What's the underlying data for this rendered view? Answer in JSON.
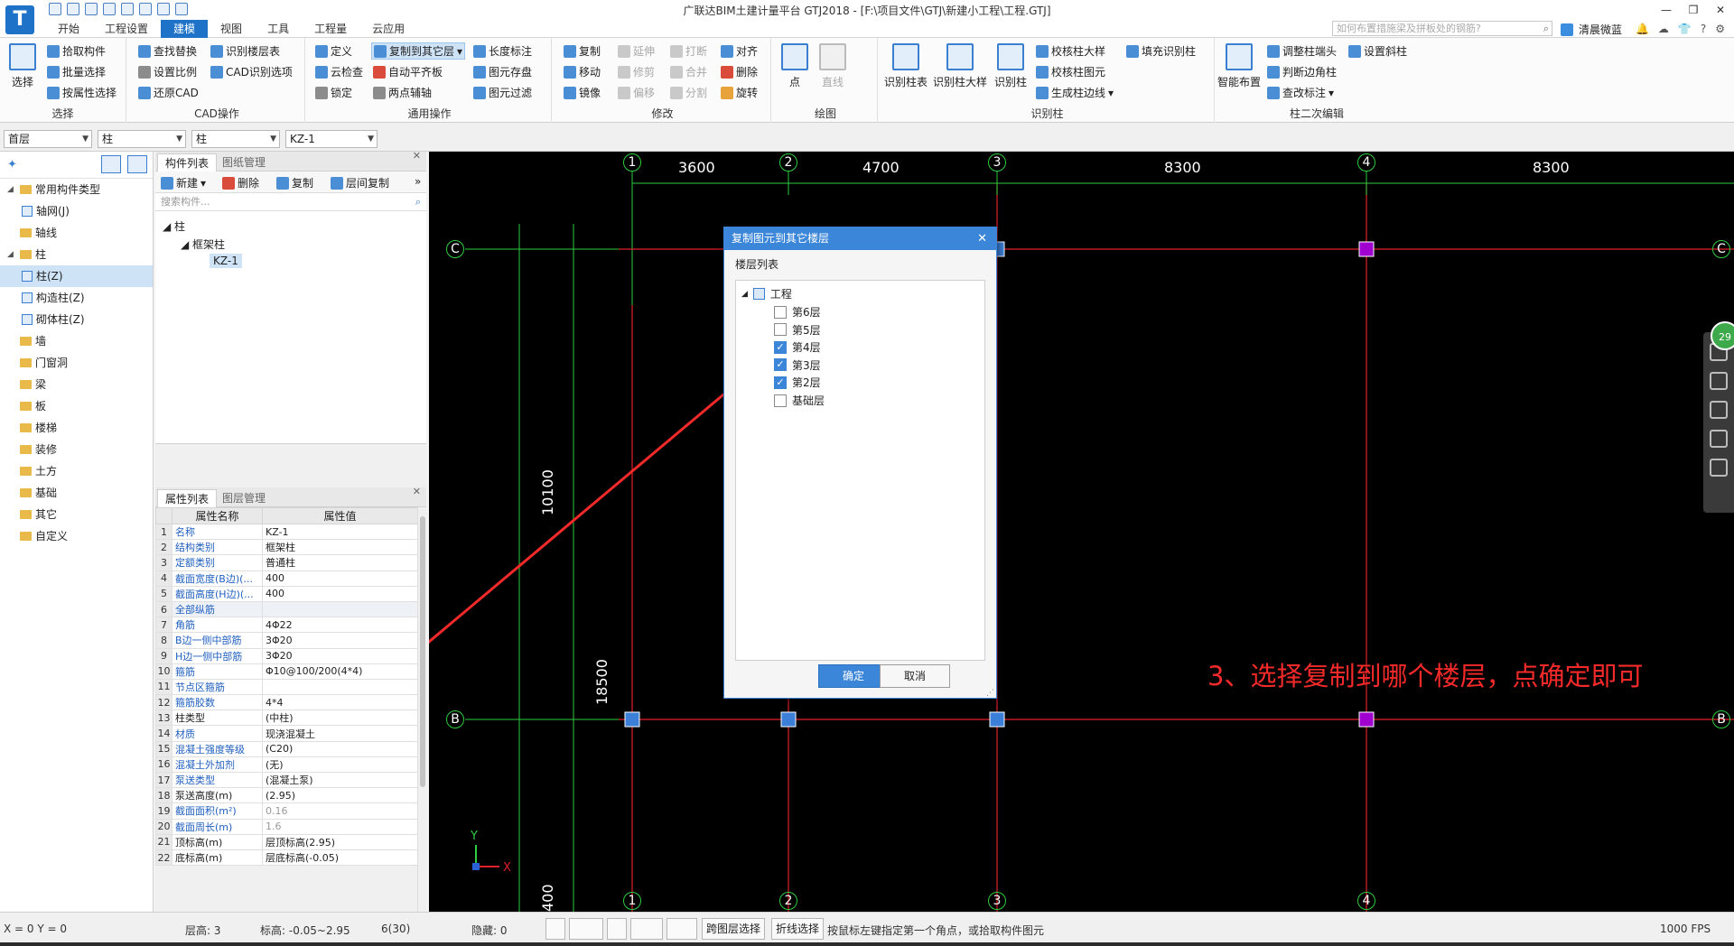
{
  "window": {
    "title": "广联达BIM土建计量平台 GTJ2018 - [F:\\项目文件\\GTJ\\新建小工程\\工程.GTJ]",
    "logo_letter": "T",
    "controls": [
      "—",
      "❐",
      "✕"
    ]
  },
  "menu_tabs": [
    "开始",
    "工程设置",
    "建模",
    "视图",
    "工具",
    "工程量",
    "云应用"
  ],
  "active_tab": "建模",
  "top_search_placeholder": "如何布置措施梁及拼板处的钢筋?",
  "user": {
    "name": "清晨微蓝"
  },
  "ribbon": {
    "select_group": {
      "label": "选择",
      "big": "选择",
      "items": [
        "拾取构件",
        "批量选择",
        "按属性选择"
      ]
    },
    "cad_group": {
      "label": "CAD操作",
      "items": [
        "查找替换",
        "识别楼层表",
        "设置比例",
        "CAD识别选项",
        "还原CAD"
      ]
    },
    "common_group": {
      "label": "通用操作",
      "items": [
        "定义",
        "复制到其它层",
        "长度标注",
        "云检查",
        "自动平齐板",
        "图元存盘",
        "锁定",
        "两点辅轴",
        "图元过滤"
      ]
    },
    "modify_group": {
      "label": "修改",
      "items": [
        "复制",
        "延伸",
        "打断",
        "对齐",
        "移动",
        "修剪",
        "合并",
        "删除",
        "镜像",
        "偏移",
        "分割",
        "旋转"
      ]
    },
    "draw_group": {
      "label": "绘图",
      "items": [
        "点",
        "直线"
      ]
    },
    "identify_group": {
      "label": "识别柱",
      "big": [
        "识别柱表",
        "识别柱大样",
        "识别柱"
      ],
      "items": [
        "校核柱大样",
        "填充识别柱",
        "校核柱图元",
        "生成柱边线"
      ]
    },
    "second_edit_group": {
      "label": "柱二次编辑",
      "big": "智能布置",
      "items": [
        "调整柱端头",
        "设置斜柱",
        "判断边角柱",
        "查改标注"
      ]
    }
  },
  "selectors": [
    "首层",
    "柱",
    "柱",
    "KZ-1"
  ],
  "left_tree": {
    "header": "常用构件类型",
    "items": [
      {
        "label": "常用构件类型",
        "level": 0,
        "expanded": true
      },
      {
        "label": "轴网(J)",
        "level": 1
      },
      {
        "label": "轴线",
        "level": 0
      },
      {
        "label": "柱",
        "level": 0,
        "expanded": true
      },
      {
        "label": "柱(Z)",
        "level": 1,
        "selected": true
      },
      {
        "label": "构造柱(Z)",
        "level": 1
      },
      {
        "label": "砌体柱(Z)",
        "level": 1
      },
      {
        "label": "墙",
        "level": 0
      },
      {
        "label": "门窗洞",
        "level": 0
      },
      {
        "label": "梁",
        "level": 0
      },
      {
        "label": "板",
        "level": 0
      },
      {
        "label": "楼梯",
        "level": 0
      },
      {
        "label": "装修",
        "level": 0
      },
      {
        "label": "土方",
        "level": 0
      },
      {
        "label": "基础",
        "level": 0
      },
      {
        "label": "其它",
        "level": 0
      },
      {
        "label": "自定义",
        "level": 0
      }
    ]
  },
  "component_panel": {
    "tabs": [
      "构件列表",
      "图纸管理"
    ],
    "tools": [
      "新建",
      "删除",
      "复制",
      "层间复制"
    ],
    "search_placeholder": "搜索构件...",
    "tree": [
      "柱",
      "框架柱",
      "KZ-1"
    ]
  },
  "property_panel": {
    "tabs": [
      "属性列表",
      "图层管理"
    ],
    "headers": [
      "属性名称",
      "属性值"
    ],
    "rows": [
      {
        "n": "1",
        "name": "名称",
        "value": "KZ-1",
        "blue": true
      },
      {
        "n": "2",
        "name": "结构类别",
        "value": "框架柱",
        "blue": true
      },
      {
        "n": "3",
        "name": "定额类别",
        "value": "普通柱",
        "blue": true
      },
      {
        "n": "4",
        "name": "截面宽度(B边)(...",
        "value": "400",
        "blue": true
      },
      {
        "n": "5",
        "name": "截面高度(H边)(...",
        "value": "400",
        "blue": true
      },
      {
        "n": "6",
        "name": "全部纵筋",
        "value": "",
        "blue": true,
        "group": true
      },
      {
        "n": "7",
        "name": "角筋",
        "value": "4Φ22",
        "blue": true
      },
      {
        "n": "8",
        "name": "B边一侧中部筋",
        "value": "3Φ20",
        "blue": true
      },
      {
        "n": "9",
        "name": "H边一侧中部筋",
        "value": "3Φ20",
        "blue": true
      },
      {
        "n": "10",
        "name": "箍筋",
        "value": "Φ10@100/200(4*4)",
        "blue": true
      },
      {
        "n": "11",
        "name": "节点区箍筋",
        "value": "",
        "blue": true
      },
      {
        "n": "12",
        "name": "箍筋胶数",
        "value": "4*4",
        "blue": true
      },
      {
        "n": "13",
        "name": "柱类型",
        "value": "(中柱)",
        "blue": false
      },
      {
        "n": "14",
        "name": "材质",
        "value": "现浇混凝土",
        "blue": true
      },
      {
        "n": "15",
        "name": "混凝土强度等级",
        "value": "(C20)",
        "blue": true
      },
      {
        "n": "16",
        "name": "混凝土外加剂",
        "value": "(无)",
        "blue": true
      },
      {
        "n": "17",
        "name": "泵送类型",
        "value": "(混凝土泵)",
        "blue": true
      },
      {
        "n": "18",
        "name": "泵送高度(m)",
        "value": "(2.95)",
        "blue": false
      },
      {
        "n": "19",
        "name": "截面面积(m²)",
        "value": "0.16",
        "blue": true,
        "gray": true
      },
      {
        "n": "20",
        "name": "截面周长(m)",
        "value": "1.6",
        "blue": true,
        "gray": true
      },
      {
        "n": "21",
        "name": "顶标高(m)",
        "value": "层顶标高(2.95)",
        "blue": false
      },
      {
        "n": "22",
        "name": "底标高(m)",
        "value": "层底标高(-0.05)",
        "blue": false
      }
    ]
  },
  "canvas": {
    "axis_top": [
      "1",
      "2",
      "3",
      "4"
    ],
    "axis_left": [
      "C",
      "B"
    ],
    "dims_top": [
      "3600",
      "4700",
      "8300",
      "8300"
    ],
    "dims_vert": [
      "10100",
      "18500",
      "400"
    ],
    "annotation": "3、选择复制到哪个楼层，点确定即可",
    "zoom_badge": "29",
    "colors": {
      "grid_red": "#e0202a",
      "dim_green": "#2ecc40",
      "column_blue": "#3b7fd8",
      "column_purple": "#a000d0"
    }
  },
  "dialog": {
    "title": "复制图元到其它楼层",
    "list_label": "楼层列表",
    "root": "工程",
    "floors": [
      {
        "label": "第6层",
        "checked": false
      },
      {
        "label": "第5层",
        "checked": false
      },
      {
        "label": "第4层",
        "checked": true
      },
      {
        "label": "第3层",
        "checked": true
      },
      {
        "label": "第2层",
        "checked": true
      },
      {
        "label": "基础层",
        "checked": false
      }
    ],
    "ok": "确定",
    "cancel": "取消"
  },
  "status": {
    "coords": "X = 0 Y = 0",
    "floor_height": "层高:  3",
    "elevation": "标高: -0.05~2.95",
    "count": "6(30)",
    "hidden": "隐藏:  0",
    "btn_cross_floor": "跨图层选择",
    "btn_polyline": "折线选择",
    "hint": "按鼠标左键指定第一个角点，或拾取构件图元",
    "fps": "1000 FPS"
  }
}
